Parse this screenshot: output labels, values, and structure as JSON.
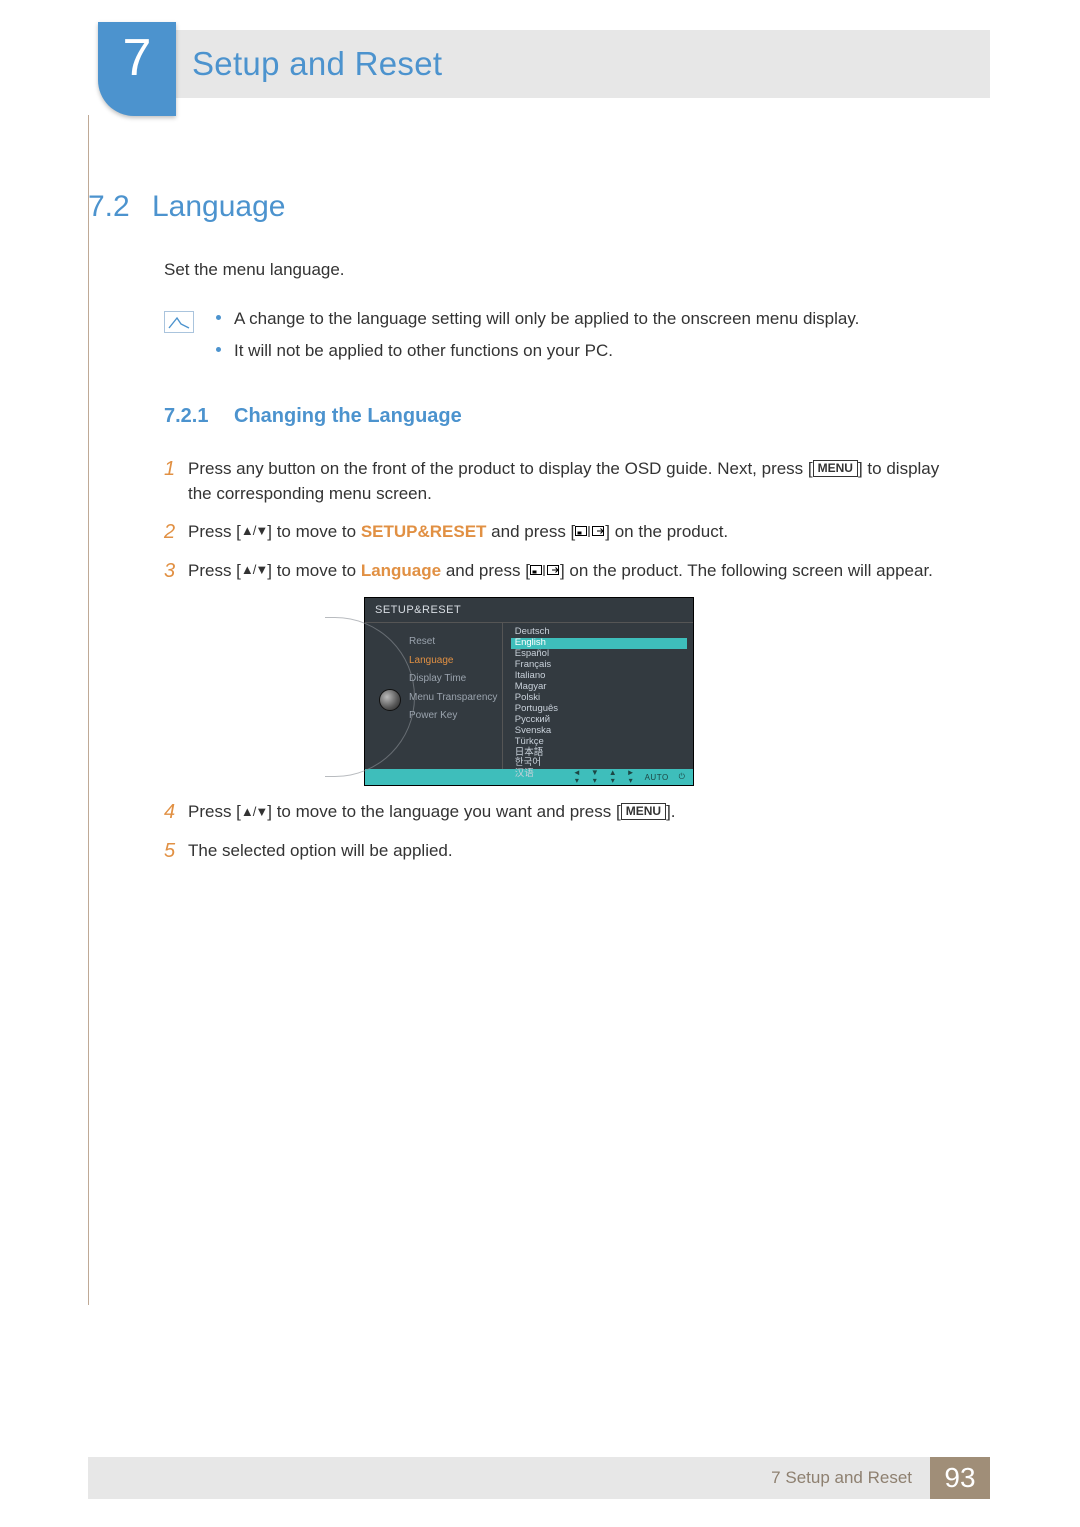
{
  "chapter": {
    "number": "7",
    "title": "Setup and Reset"
  },
  "section": {
    "number": "7.2",
    "title": "Language",
    "intro": "Set the menu language.",
    "notes": [
      "A change to the language setting will only be applied to the onscreen menu display.",
      "It will not be applied to other functions on your PC."
    ]
  },
  "subsection": {
    "number": "7.2.1",
    "title": "Changing the Language"
  },
  "steps": {
    "s1_a": "Press any button on the front of the product to display the OSD guide. Next, press [",
    "s1_menu": "MENU",
    "s1_b": "] to display the corresponding menu screen.",
    "s2_a": "Press [",
    "s2_b": "] to move to ",
    "s2_hl": "SETUP&RESET",
    "s2_c": " and press [",
    "s2_d": "] on the product.",
    "s3_a": "Press [",
    "s3_b": "] to move to ",
    "s3_hl": "Language",
    "s3_c": " and press [",
    "s3_d": "] on the product. The following screen will appear.",
    "s4_a": "Press [",
    "s4_b": "] to move to the language you want and press [",
    "s4_menu": "MENU",
    "s4_c": "].",
    "s5": "The selected option will be applied."
  },
  "osd": {
    "title": "SETUP&RESET",
    "left_items": [
      "Reset",
      "Language",
      "Display Time",
      "Menu Transparency",
      "Power Key"
    ],
    "selected_left": "Language",
    "right_items": [
      "Deutsch",
      "English",
      "Español",
      "Français",
      "Italiano",
      "Magyar",
      "Polski",
      "Português",
      "Русский",
      "Svenska",
      "Türkçe",
      "日本語",
      "한국어",
      "汉语"
    ],
    "highlighted_right": "English",
    "footer_auto": "AUTO"
  },
  "footer": {
    "text": "7 Setup and Reset",
    "page": "93"
  }
}
